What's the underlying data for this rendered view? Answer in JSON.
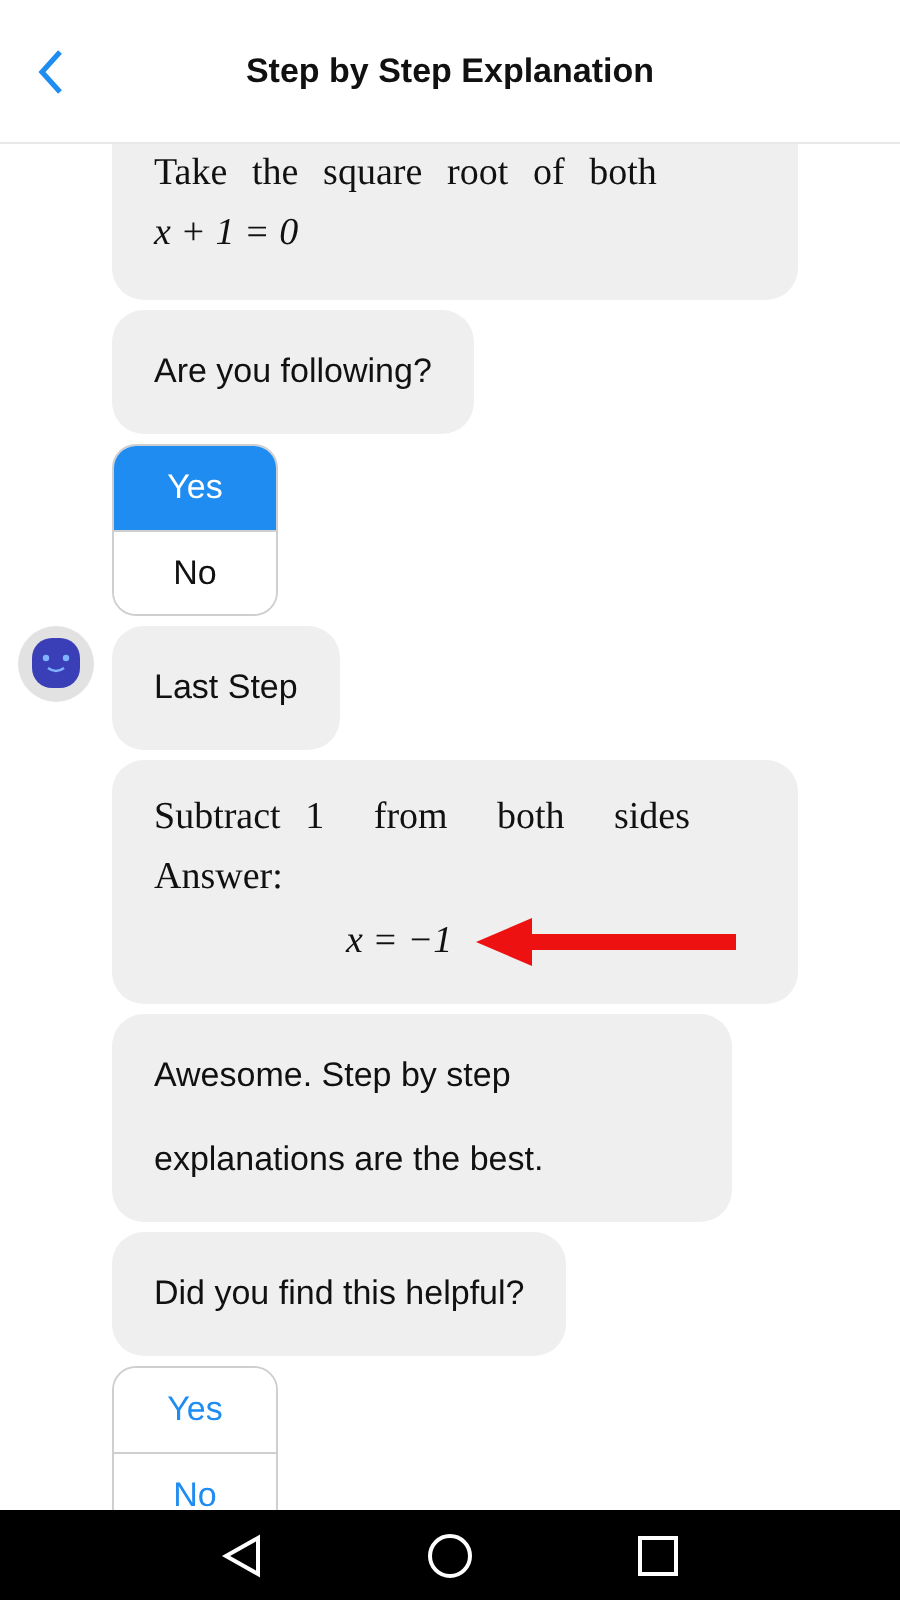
{
  "header": {
    "title": "Step by Step Explanation"
  },
  "messages": [
    {
      "kind": "math",
      "lines": [
        {
          "kind": "prose",
          "text": "Take the square root of both"
        },
        {
          "kind": "equation",
          "text": "x + 1 = 0"
        }
      ]
    },
    {
      "kind": "text",
      "text": "Are you following?"
    },
    {
      "kind": "choices",
      "answered": true,
      "options": [
        {
          "label": "Yes",
          "selected": true
        },
        {
          "label": "No",
          "selected": false
        }
      ]
    },
    {
      "kind": "text",
      "text": "Last Step",
      "avatar": true
    },
    {
      "kind": "math",
      "lines": [
        {
          "kind": "prose",
          "text": "Subtract 1  from  both  sides"
        },
        {
          "kind": "prose",
          "text": "Answer:"
        },
        {
          "kind": "answer",
          "text": "x = −1"
        }
      ]
    },
    {
      "kind": "text",
      "text": "Awesome. Step by step explanations are the best."
    },
    {
      "kind": "text",
      "text": "Did you find this helpful?"
    },
    {
      "kind": "choices",
      "answered": false,
      "options": [
        {
          "label": "Yes",
          "selected": false
        },
        {
          "label": "No",
          "selected": false
        }
      ]
    }
  ]
}
